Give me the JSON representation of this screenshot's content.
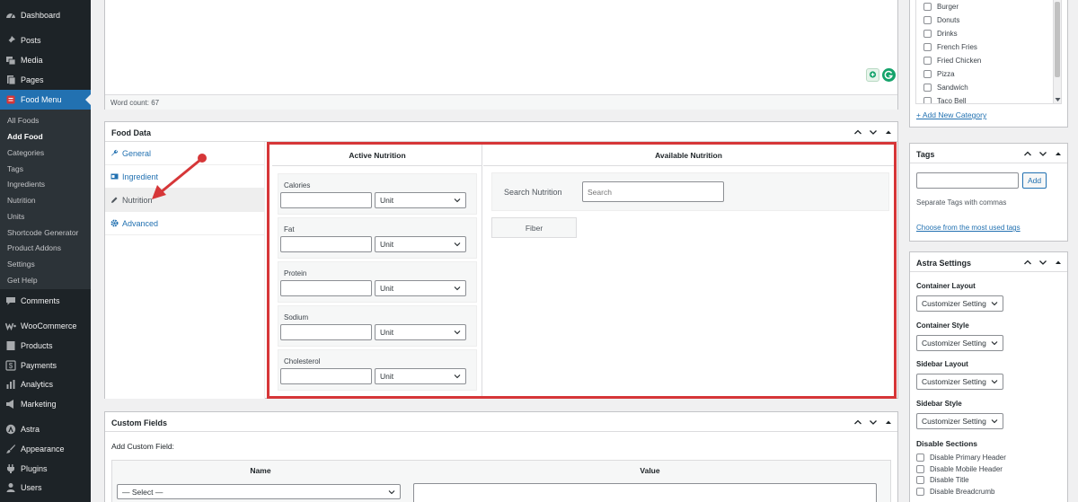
{
  "sidebar": {
    "menu_top": [
      {
        "label": "Dashboard",
        "icon": "dashboard-icon"
      },
      {
        "label": "Posts",
        "icon": "pin-icon"
      },
      {
        "label": "Media",
        "icon": "media-icon"
      },
      {
        "label": "Pages",
        "icon": "pages-icon"
      },
      {
        "label": "Food Menu",
        "icon": "food-menu-icon"
      }
    ],
    "submenu": [
      "All Foods",
      "Add Food",
      "Categories",
      "Tags",
      "Ingredients",
      "Nutrition",
      "Units",
      "Shortcode Generator",
      "Product Addons",
      "Settings",
      "Get Help"
    ],
    "menu_bottom": [
      {
        "label": "Comments",
        "icon": "comments-icon"
      },
      {
        "label": "WooCommerce",
        "icon": "woocommerce-icon"
      },
      {
        "label": "Products",
        "icon": "products-icon"
      },
      {
        "label": "Payments",
        "icon": "payments-icon"
      },
      {
        "label": "Analytics",
        "icon": "analytics-icon"
      },
      {
        "label": "Marketing",
        "icon": "marketing-icon"
      },
      {
        "label": "Astra",
        "icon": "astra-icon"
      },
      {
        "label": "Appearance",
        "icon": "appearance-icon"
      },
      {
        "label": "Plugins",
        "icon": "plugins-icon"
      },
      {
        "label": "Users",
        "icon": "users-icon"
      }
    ]
  },
  "editor": {
    "word_count": "Word count: 67"
  },
  "food_data": {
    "title": "Food Data",
    "tabs": [
      "General",
      "Ingredient",
      "Nutrition",
      "Advanced"
    ],
    "active_nutrition_title": "Active Nutrition",
    "available_nutrition_title": "Available Nutrition",
    "nutrition_items": [
      "Calories",
      "Fat",
      "Protein",
      "Sodium",
      "Cholesterol"
    ],
    "unit_placeholder": "Unit",
    "search_label": "Search Nutrition",
    "search_placeholder": "Search",
    "available_items": [
      "Fiber"
    ]
  },
  "custom_fields": {
    "title": "Custom Fields",
    "add_label": "Add Custom Field:",
    "col_name": "Name",
    "col_value": "Value",
    "select_default": "— Select —"
  },
  "categories": {
    "items": [
      "Burger",
      "Donuts",
      "Drinks",
      "French Fries",
      "Fried Chicken",
      "Pizza",
      "Sandwich",
      "Taco Bell"
    ],
    "add_new": "+ Add New Category"
  },
  "tags": {
    "title": "Tags",
    "add_button": "Add",
    "hint": "Separate Tags with commas",
    "choose_link": "Choose from the most used tags"
  },
  "astra": {
    "title": "Astra Settings",
    "fields": [
      {
        "label": "Container Layout",
        "value": "Customizer Setting"
      },
      {
        "label": "Container Style",
        "value": "Customizer Setting"
      },
      {
        "label": "Sidebar Layout",
        "value": "Customizer Setting"
      },
      {
        "label": "Sidebar Style",
        "value": "Customizer Setting"
      }
    ],
    "disable_title": "Disable Sections",
    "disable_items": [
      "Disable Primary Header",
      "Disable Mobile Header",
      "Disable Title",
      "Disable Breadcrumb"
    ]
  },
  "colors": {
    "accent": "#2271b1",
    "highlight": "#d63638",
    "sidebar_bg": "#1d2327"
  }
}
